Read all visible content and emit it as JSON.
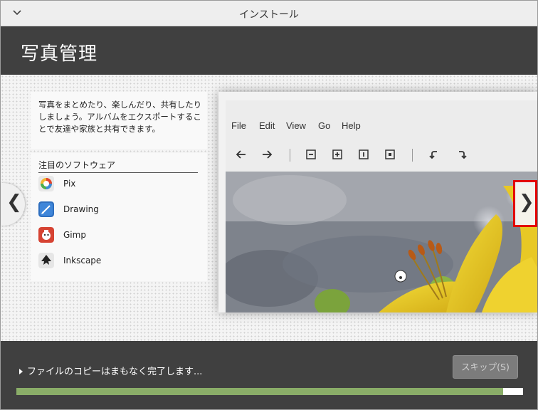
{
  "window": {
    "title": "インストール"
  },
  "header": {
    "title": "写真管理"
  },
  "description": "写真をまとめたり、楽しんだり、共有したりしましょう。アルバムをエクスポートすることで友達や家族と共有できます。",
  "software": {
    "heading": "注目のソフトウェア",
    "apps": [
      {
        "name": "Pix",
        "icon": "pix-icon"
      },
      {
        "name": "Drawing",
        "icon": "drawing-icon"
      },
      {
        "name": "Gimp",
        "icon": "gimp-icon"
      },
      {
        "name": "Inkscape",
        "icon": "inkscape-icon"
      }
    ]
  },
  "preview": {
    "menu": [
      "File",
      "Edit",
      "View",
      "Go",
      "Help"
    ]
  },
  "footer": {
    "status": "ファイルのコピーはまもなく完了します...",
    "skip_label": "スキップ(S)",
    "progress": 0.96
  },
  "colors": {
    "header_bg": "#404040",
    "progress_fill": "#8aad68",
    "highlight": "#e30000"
  }
}
